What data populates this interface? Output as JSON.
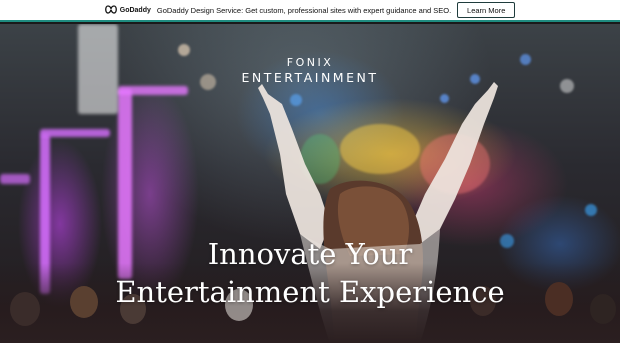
{
  "promo": {
    "logo_text": "GoDaddy",
    "message": "GoDaddy Design Service: Get custom, professional sites with expert guidance and SEO.",
    "button_label": "Learn More",
    "accent": "#1f8c80"
  },
  "hero": {
    "brand_line1": "FONIX",
    "brand_line2": "ENTERTAINMENT",
    "headline_line1": "Innovate Your",
    "headline_line2": "Entertainment Experience"
  }
}
